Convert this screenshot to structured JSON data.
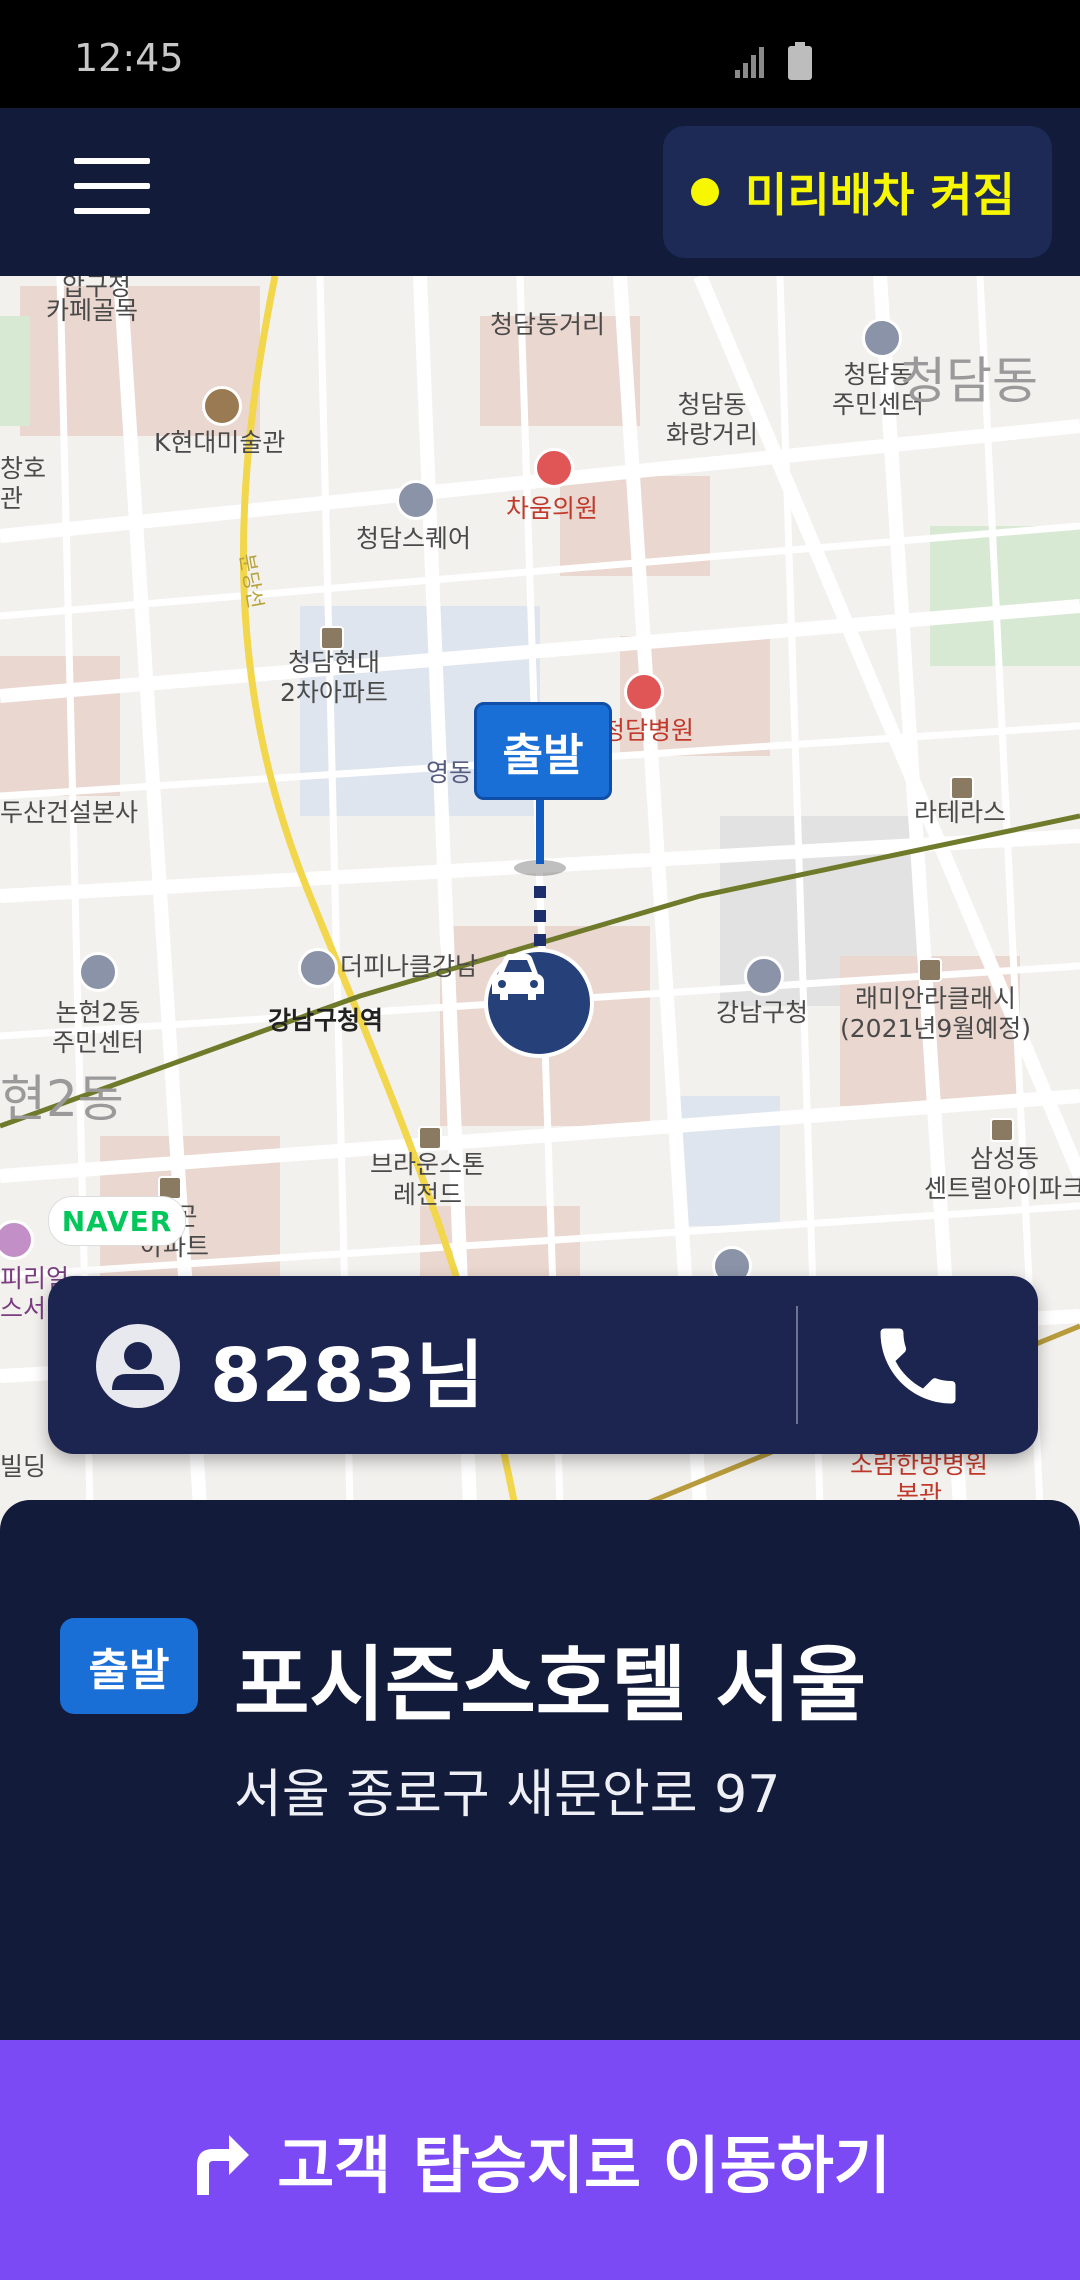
{
  "status_bar": {
    "time": "12:45"
  },
  "header": {
    "dispatch_label": "미리배차 켜짐"
  },
  "map": {
    "labels": {
      "cafe": "카페골목",
      "cafe_top": "압구정",
      "chungdam_street": "청담동거리",
      "chungdam_center": "청담동\n주민센터",
      "chungdam_dong": "청담동",
      "hwarang": "청담동\n화랑거리",
      "k_museum": "K현대미술관",
      "chaum": "차움의원",
      "chungdam_square": "청담스퀘어",
      "hyundai2": "청담현대\n2차아파트",
      "chungdam_hospital": "청담병원",
      "youngdong": "영동",
      "doosan": "두산건설본사",
      "lateras": "라테라스",
      "the_pinnacle": "더피나클강남",
      "gangnam_station": "강남구청역",
      "nonhyeon_center": "논현2동\n주민센터",
      "gangnam_office": "강남구청",
      "raemian": "래미안라클래시\n(2021년9월예정)",
      "nonhyeon_dong": "현2동",
      "brownstone": "브라운스톤\n레전드",
      "samsung_center": "삼성동\n센트럴아이파크",
      "line_name": "분당선",
      "left_edge": "창호\n관",
      "apt_left": "각곤\n아파트",
      "hospital_bottom": "소람한방병원\n본관",
      "bldg_bottom": "빌딩",
      "left_bottom": "피리얼\n스서"
    },
    "depart_marker": "출발",
    "naver_logo": "NAVER"
  },
  "passenger": {
    "name": "8283님"
  },
  "destination": {
    "tag": "출발",
    "place_name": "포시즌스호텔 서울",
    "address": "서울 종로구 새문안로 97"
  },
  "action": {
    "label": "고객 탑승지로 이동하기"
  },
  "colors": {
    "header_bg": "#121b3a",
    "accent_yellow": "#f7f700",
    "depart_blue": "#1a6fd6",
    "action_purple": "#7b4af4"
  }
}
